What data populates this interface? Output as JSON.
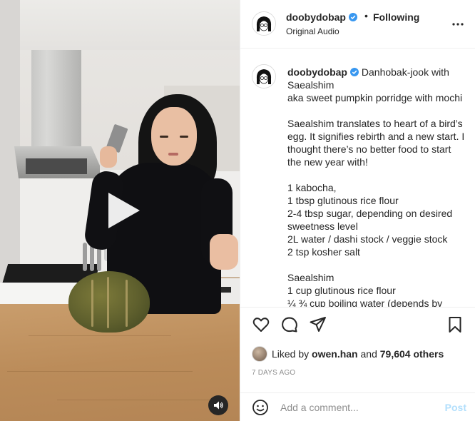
{
  "video": {
    "play_icon": "play-icon",
    "audio_icon": "speaker-icon"
  },
  "header": {
    "username": "doobydobap",
    "separator": "•",
    "follow_status": "Following",
    "audio_label": "Original Audio",
    "more_icon": "more-horizontal-icon"
  },
  "caption": {
    "username": "doobydobap",
    "lines": [
      "Danhobak-jook with Saealshim",
      "aka sweet pumpkin porridge with mochi",
      "Saealshim translates to heart of a bird’s egg. It signifies rebirth and a new start. I thought there’s no better food to start the new year with!",
      "1 kabocha,",
      "1 tbsp glutinous rice flour",
      "2-4 tbsp sugar, depending on desired sweetness level",
      "2L water / dashi stock / veggie stock",
      "2 tsp kosher salt",
      "Saealshim",
      "1 cup glutinous rice flour",
      "¼ ¾ cup boiling water (depends by"
    ]
  },
  "likes": {
    "prefix": "Liked by",
    "user": "owen.han",
    "middle": "and",
    "count": "79,604 others"
  },
  "timestamp": "7 DAYS AGO",
  "comment": {
    "placeholder": "Add a comment...",
    "post_label": "Post"
  },
  "colors": {
    "verified": "#3897f0",
    "post_disabled": "#b2dffc",
    "text": "#262626",
    "muted": "#8e8e8e"
  }
}
